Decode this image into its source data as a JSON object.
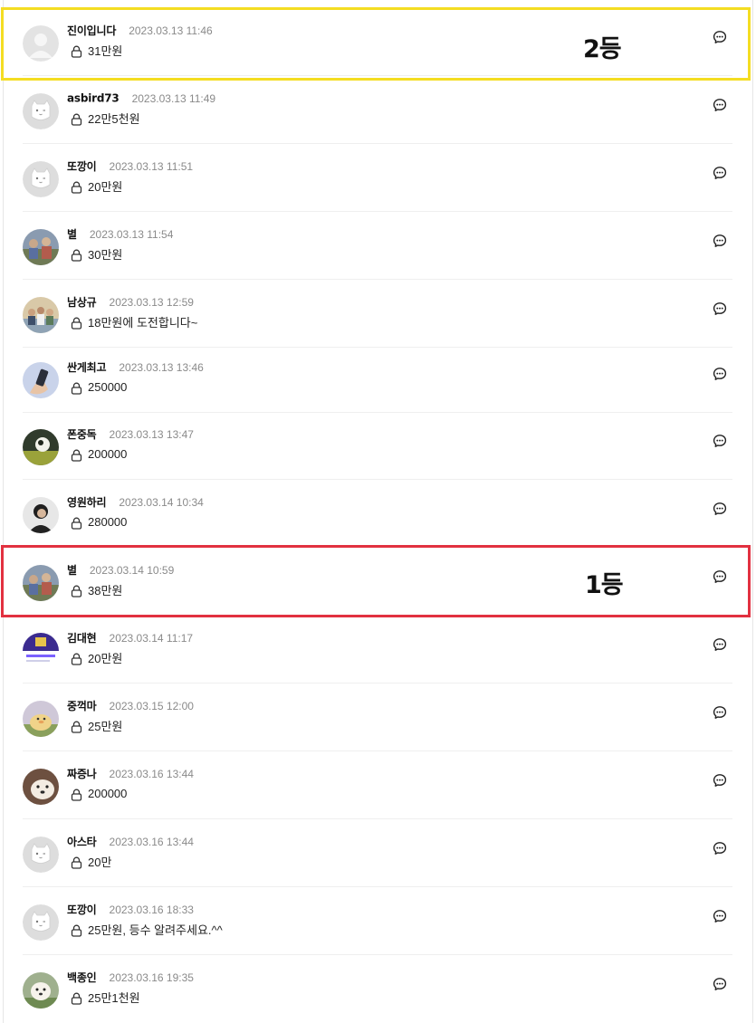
{
  "comments": [
    {
      "avatar": "default",
      "name": "진이입니다",
      "date": "2023.03.13 11:46",
      "text": "31만원"
    },
    {
      "avatar": "cat",
      "name": "asbird73",
      "date": "2023.03.13 11:49",
      "text": "22만5천원"
    },
    {
      "avatar": "cat",
      "name": "또깡이",
      "date": "2023.03.13 11:51",
      "text": "20만원"
    },
    {
      "avatar": "photo-group",
      "name": "별",
      "date": "2023.03.13 11:54",
      "text": "30만원"
    },
    {
      "avatar": "photo-people",
      "name": "남상규",
      "date": "2023.03.13 12:59",
      "text": "18만원에 도전합니다~"
    },
    {
      "avatar": "photo-phone",
      "name": "싼게최고",
      "date": "2023.03.13 13:46",
      "text": "250000"
    },
    {
      "avatar": "photo-landscape",
      "name": "폰중독",
      "date": "2023.03.13 13:47",
      "text": "200000"
    },
    {
      "avatar": "photo-portrait",
      "name": "영원하리",
      "date": "2023.03.14 10:34",
      "text": "280000"
    },
    {
      "avatar": "photo-group",
      "name": "별",
      "date": "2023.03.14 10:59",
      "text": "38만원"
    },
    {
      "avatar": "photo-screen",
      "name": "김대현",
      "date": "2023.03.14 11:17",
      "text": "20만원"
    },
    {
      "avatar": "photo-duck",
      "name": "중꺽마",
      "date": "2023.03.15 12:00",
      "text": "25만원"
    },
    {
      "avatar": "photo-dog",
      "name": "짜증나",
      "date": "2023.03.16 13:44",
      "text": "200000"
    },
    {
      "avatar": "cat",
      "name": "아스타",
      "date": "2023.03.16 13:44",
      "text": "20만"
    },
    {
      "avatar": "cat",
      "name": "또깡이",
      "date": "2023.03.16 18:33",
      "text": "25만원, 등수 알려주세요.^^"
    },
    {
      "avatar": "photo-puppy",
      "name": "백종인",
      "date": "2023.03.16 19:35",
      "text": "25만1천원"
    }
  ],
  "annotations": {
    "second_place_label": "2등",
    "first_place_label": "1등",
    "second_place_color": "#f4dd22",
    "first_place_color": "#e23140"
  },
  "icons": {
    "secret": "lock-icon",
    "reply": "speech-bubble-icon"
  }
}
